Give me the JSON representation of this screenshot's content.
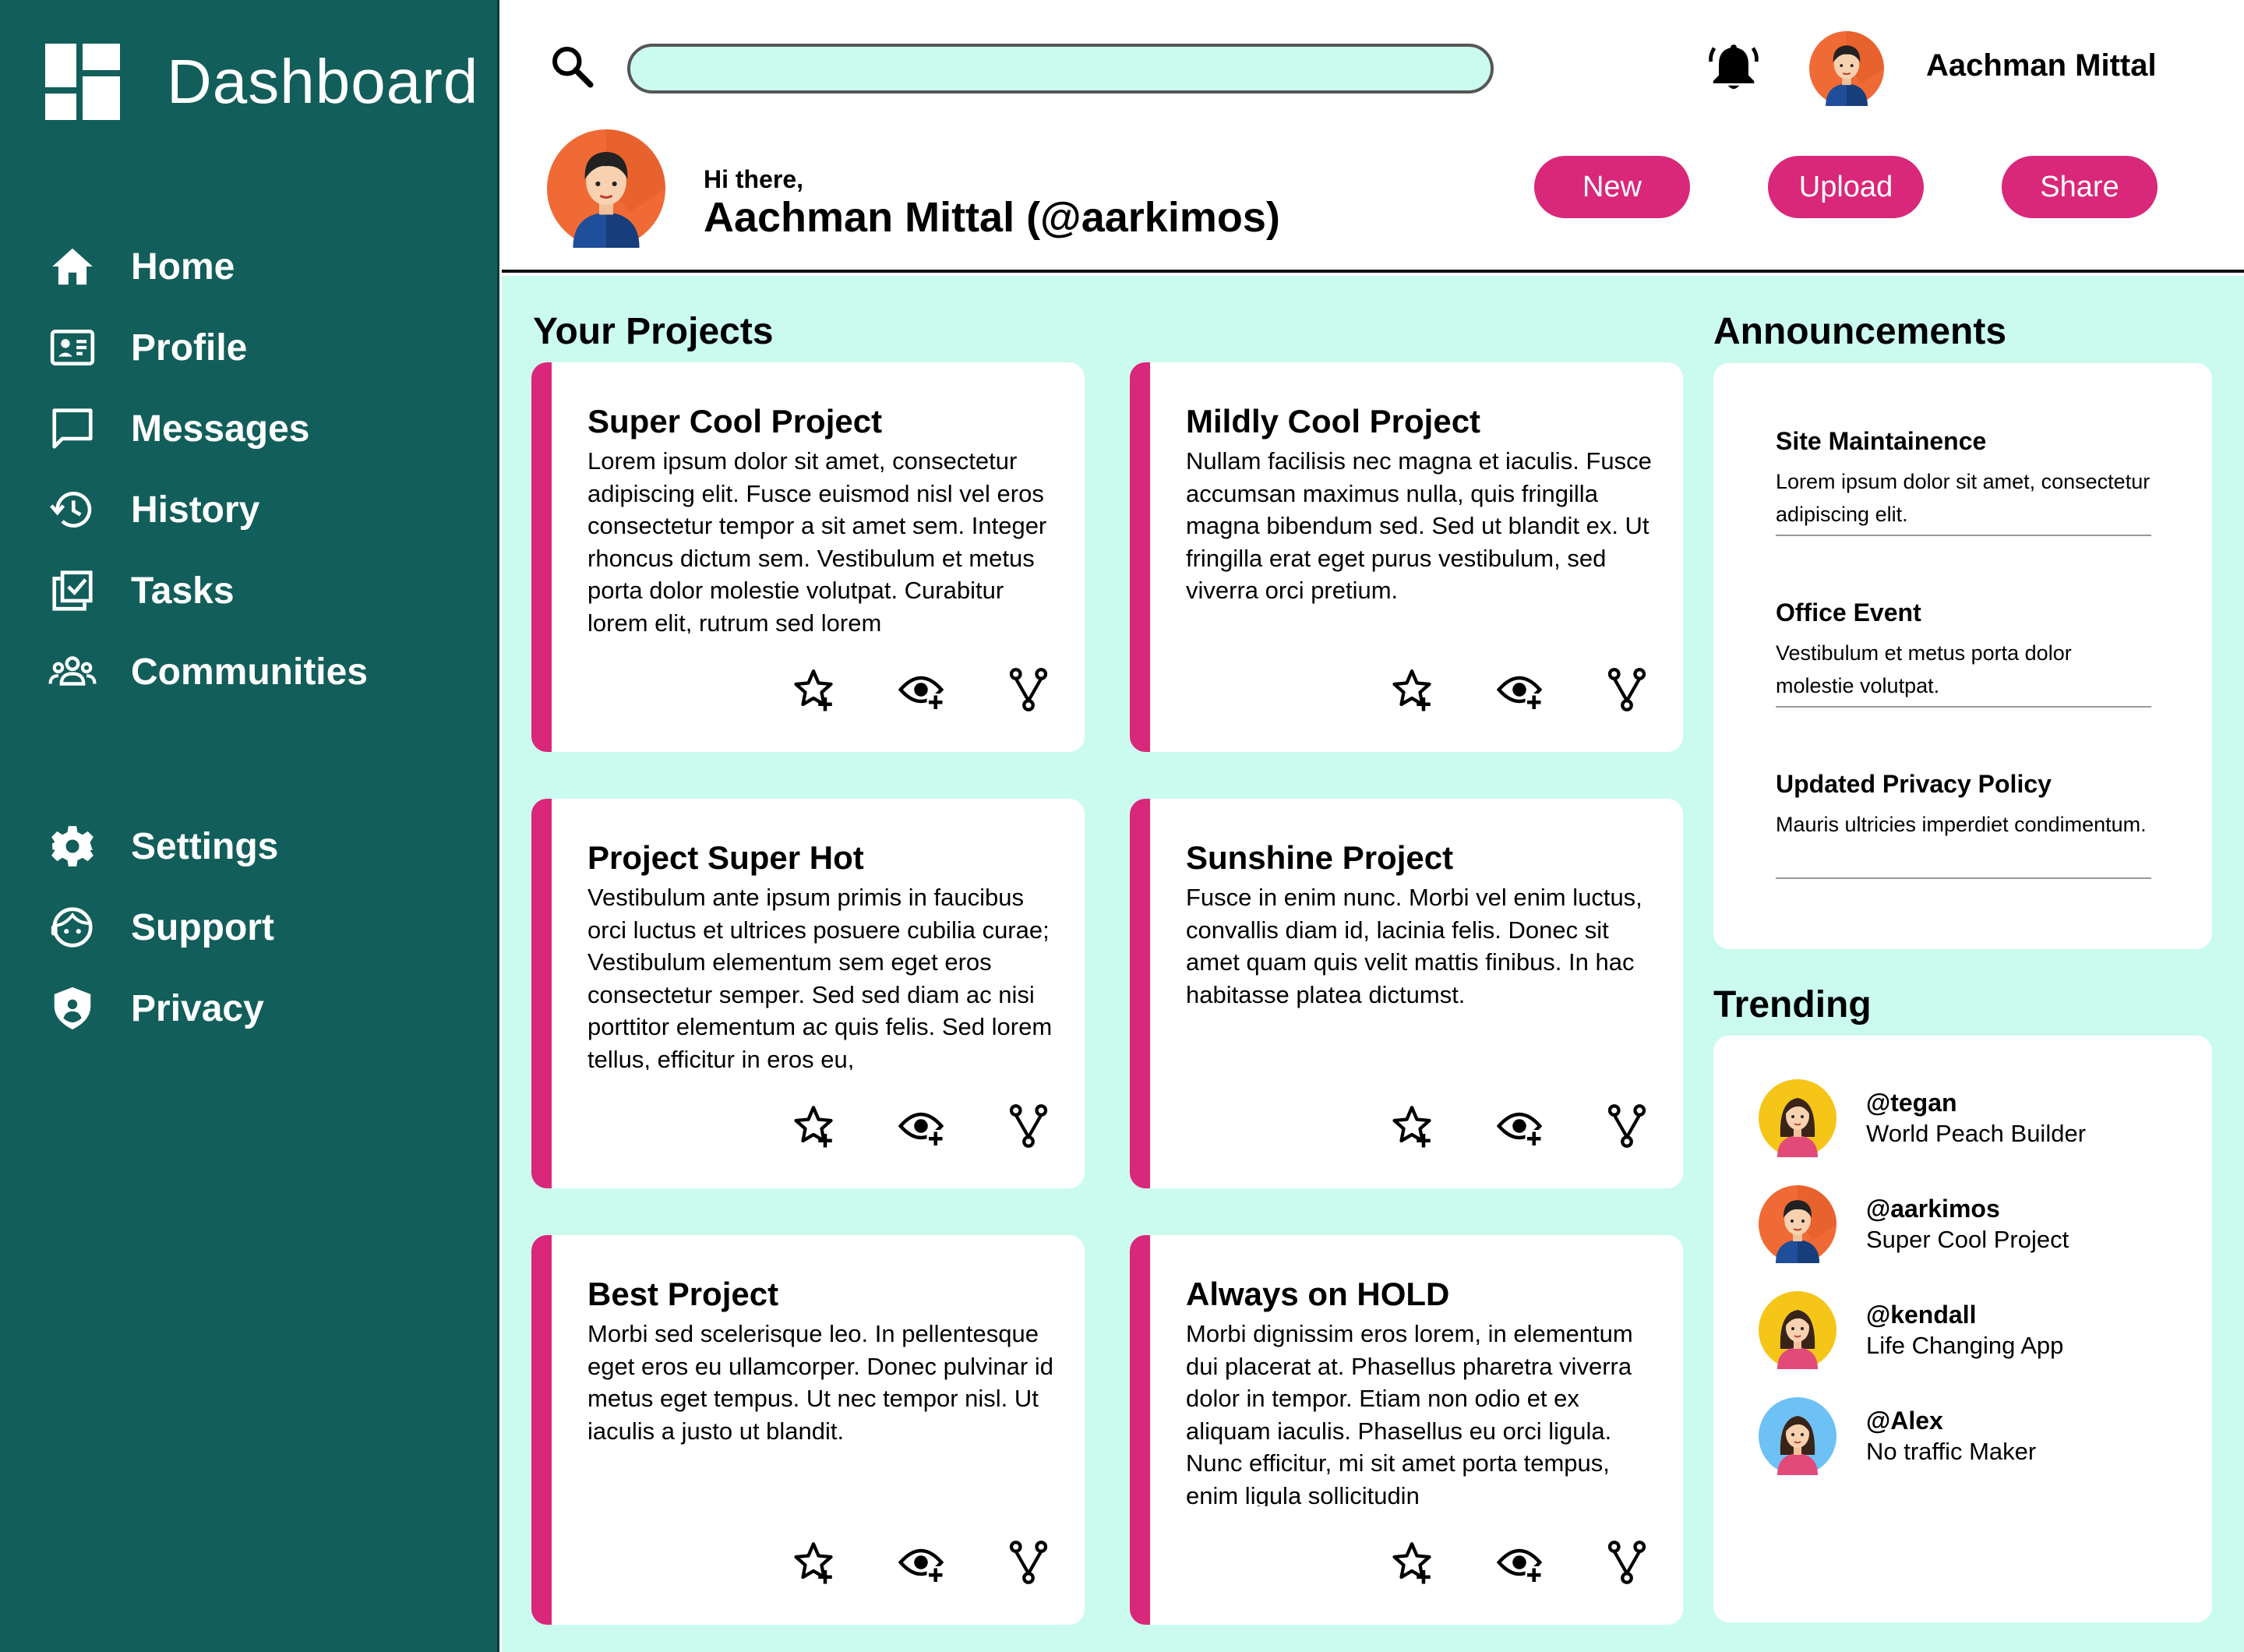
{
  "sidebar": {
    "title": "Dashboard",
    "nav": [
      {
        "label": "Home",
        "icon": "home-icon"
      },
      {
        "label": "Profile",
        "icon": "profile-card-icon"
      },
      {
        "label": "Messages",
        "icon": "message-icon"
      },
      {
        "label": "History",
        "icon": "history-icon"
      },
      {
        "label": "Tasks",
        "icon": "tasks-icon"
      },
      {
        "label": "Communities",
        "icon": "communities-icon"
      }
    ],
    "nav_secondary": [
      {
        "label": "Settings",
        "icon": "gear-icon"
      },
      {
        "label": "Support",
        "icon": "support-icon"
      },
      {
        "label": "Privacy",
        "icon": "shield-icon"
      }
    ]
  },
  "header": {
    "search_placeholder": "",
    "user_name": "Aachman Mittal",
    "greeting": "Hi there,",
    "greeting_name": "Aachman Mittal (@aarkimos)",
    "buttons": {
      "new": "New",
      "upload": "Upload",
      "share": "Share"
    }
  },
  "projects": {
    "title": "Your Projects",
    "items": [
      {
        "title": "Super Cool Project",
        "body": "Lorem ipsum dolor sit amet, consectetur adipiscing elit. Fusce euismod nisl vel eros consectetur tempor a sit amet sem. Integer rhoncus dictum sem. Vestibulum et metus porta dolor molestie volutpat. Curabitur lorem elit, rutrum sed lorem"
      },
      {
        "title": "Mildly Cool Project",
        "body": "Nullam facilisis nec magna et iaculis. Fusce accumsan maximus nulla, quis fringilla magna bibendum sed. Sed ut blandit ex. Ut fringilla erat eget purus vestibulum, sed viverra orci pretium."
      },
      {
        "title": "Project Super Hot",
        "body": "Vestibulum ante ipsum primis in faucibus orci luctus et ultrices posuere cubilia curae; Vestibulum elementum sem eget eros consectetur semper. Sed sed diam ac nisi porttitor elementum ac quis felis. Sed lorem tellus, efficitur in eros eu,"
      },
      {
        "title": "Sunshine Project",
        "body": "Fusce in enim nunc. Morbi vel enim luctus, convallis diam id, lacinia felis. Donec sit amet quam quis velit mattis finibus. In hac habitasse platea dictumst."
      },
      {
        "title": "Best Project",
        "body": "Morbi sed scelerisque leo. In pellentesque eget eros eu ullamcorper. Donec pulvinar id metus eget tempus. Ut nec tempor nisl. Ut iaculis a justo ut blandit."
      },
      {
        "title": "Always on HOLD",
        "body": "Morbi dignissim eros lorem, in elementum dui placerat at. Phasellus pharetra viverra dolor in tempor. Etiam non odio et ex aliquam iaculis. Phasellus eu orci ligula. Nunc efficitur, mi sit amet porta tempus, enim ligula sollicitudin"
      }
    ]
  },
  "announcements": {
    "title": "Announcements",
    "items": [
      {
        "title": "Site Maintainence",
        "text": "Lorem ipsum dolor sit amet, consectetur adipiscing elit."
      },
      {
        "title": "Office Event",
        "text": "Vestibulum et metus porta dolor molestie volutpat."
      },
      {
        "title": "Updated Privacy Policy",
        "text": "Mauris ultricies imperdiet condimentum."
      }
    ]
  },
  "trending": {
    "title": "Trending",
    "items": [
      {
        "handle": "@tegan",
        "desc": "World Peach Builder",
        "bg": "#f5c518"
      },
      {
        "handle": "@aarkimos",
        "desc": "Super Cool Project",
        "bg": "#f06a35"
      },
      {
        "handle": "@kendall",
        "desc": "Life Changing App",
        "bg": "#f5c518"
      },
      {
        "handle": "@Alex",
        "desc": "No traffic Maker",
        "bg": "#6ec1f5"
      }
    ]
  },
  "colors": {
    "sidebar": "#125e5a",
    "accent": "#d9277a",
    "main_bg": "#cbfbef"
  }
}
